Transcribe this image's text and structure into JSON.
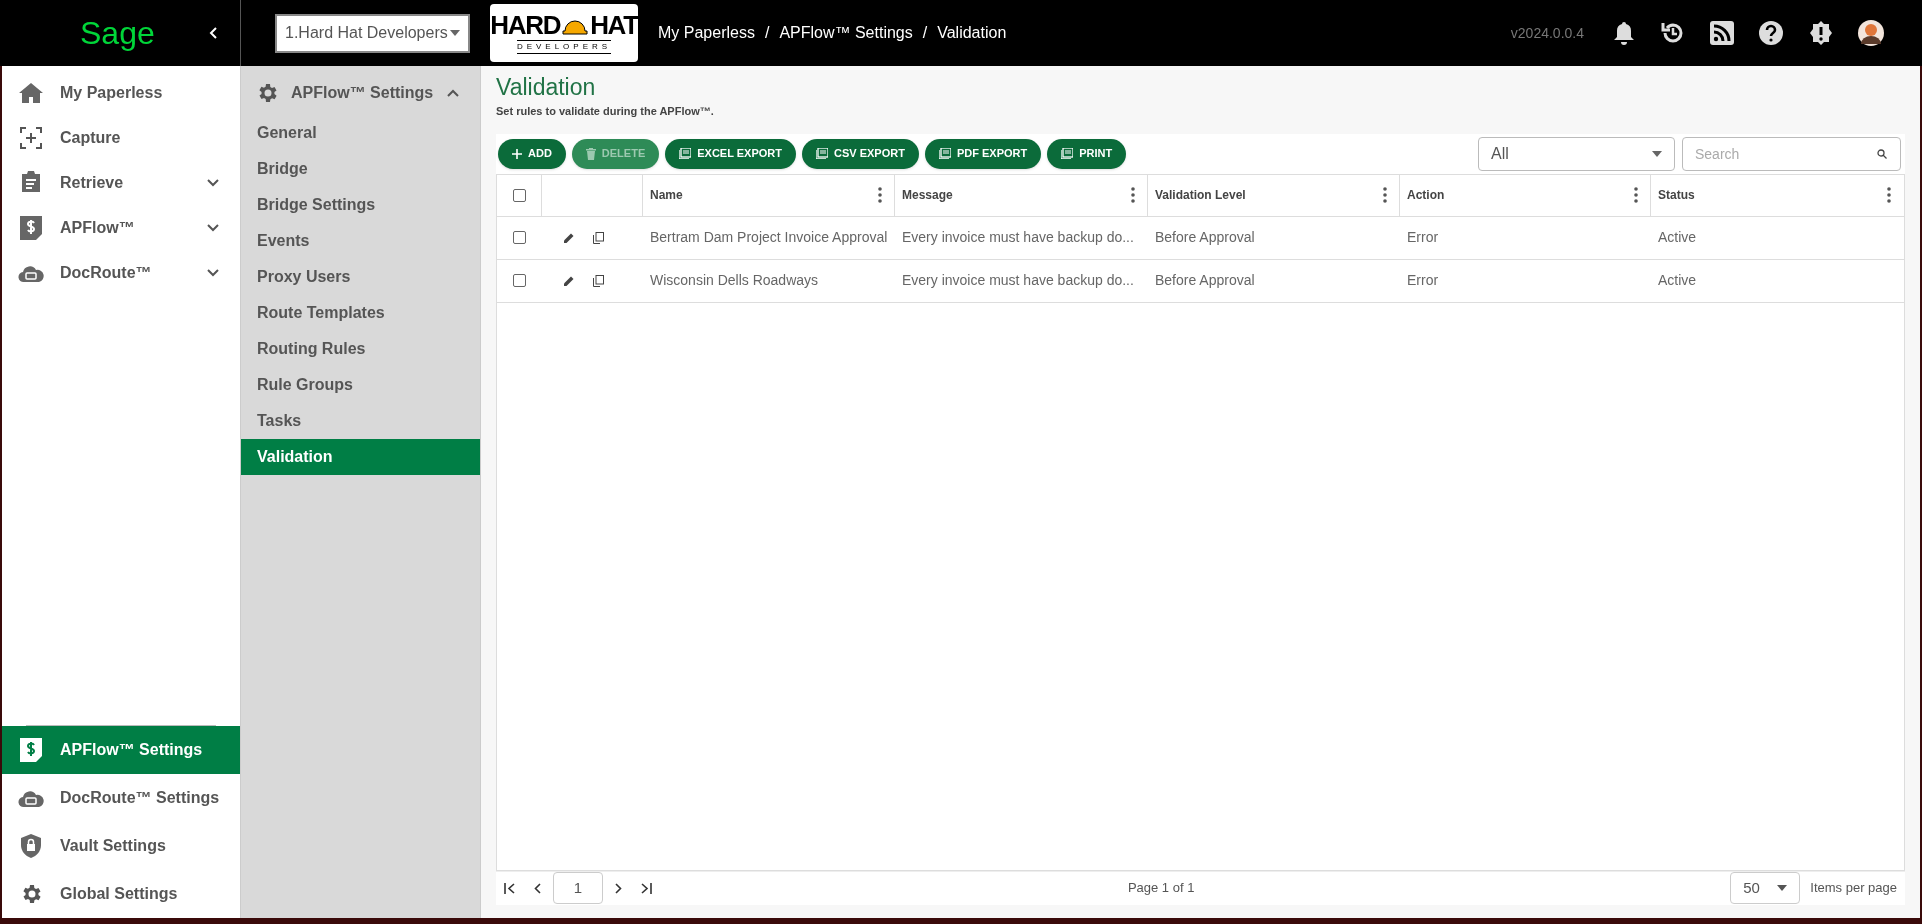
{
  "topbar": {
    "logo": "Sage",
    "company": "1.Hard Hat Developers",
    "brand": {
      "line1": "HARD",
      "line2": "HAT",
      "line3": "DEVELOPERS"
    },
    "breadcrumbs": [
      {
        "label": "My Paperless",
        "separator": "/"
      },
      {
        "label": "APFlow™ Settings",
        "separator": "/"
      },
      {
        "label": "Validation"
      }
    ],
    "version": "v2024.0.0.4"
  },
  "sidebar": {
    "items": [
      {
        "label": "My Paperless"
      },
      {
        "label": "Capture"
      },
      {
        "label": "Retrieve",
        "expanded": false
      },
      {
        "label": "APFlow™",
        "expanded": false
      },
      {
        "label": "DocRoute™",
        "expanded": false
      }
    ],
    "bottom_items": [
      {
        "label": "APFlow™ Settings",
        "selected": true
      },
      {
        "label": "DocRoute™ Settings",
        "selected": false
      },
      {
        "label": "Vault Settings",
        "selected": false
      },
      {
        "label": "Global Settings",
        "selected": false
      }
    ]
  },
  "submenu": {
    "title": "APFlow™ Settings",
    "expanded": true,
    "items": [
      {
        "label": "General",
        "selected": false
      },
      {
        "label": "Bridge",
        "selected": false
      },
      {
        "label": "Bridge Settings",
        "selected": false
      },
      {
        "label": "Events",
        "selected": false
      },
      {
        "label": "Proxy Users",
        "selected": false
      },
      {
        "label": "Route Templates",
        "selected": false
      },
      {
        "label": "Routing Rules",
        "selected": false
      },
      {
        "label": "Rule Groups",
        "selected": false
      },
      {
        "label": "Tasks",
        "selected": false
      },
      {
        "label": "Validation",
        "selected": true
      }
    ]
  },
  "page": {
    "title": "Validation",
    "subtitle": "Set rules to validate during the APFlow™."
  },
  "toolbar": {
    "buttons": [
      {
        "label": "ADD",
        "disabled": false
      },
      {
        "label": "DELETE",
        "disabled": true
      },
      {
        "label": "EXCEL EXPORT",
        "disabled": false
      },
      {
        "label": "CSV EXPORT",
        "disabled": false
      },
      {
        "label": "PDF EXPORT",
        "disabled": false
      },
      {
        "label": "PRINT",
        "disabled": false
      }
    ],
    "filter": "All",
    "search": {
      "placeholder": "Search"
    }
  },
  "table": {
    "header_checked": false,
    "columns": [
      "Name",
      "Message",
      "Validation Level",
      "Action",
      "Status"
    ],
    "rows": [
      {
        "checked": false,
        "cells": [
          "Bertram Dam Project Invoice Approval",
          "Every invoice must have backup do...",
          "Before Approval",
          "Error",
          "Active"
        ]
      },
      {
        "checked": false,
        "cells": [
          "Wisconsin Dells Roadways",
          "Every invoice must have backup do...",
          "Before Approval",
          "Error",
          "Active"
        ]
      }
    ]
  },
  "pagination": {
    "page": "1",
    "info": "Page 1 of 1",
    "page_size": "50",
    "page_size_label": "Items per page"
  }
}
